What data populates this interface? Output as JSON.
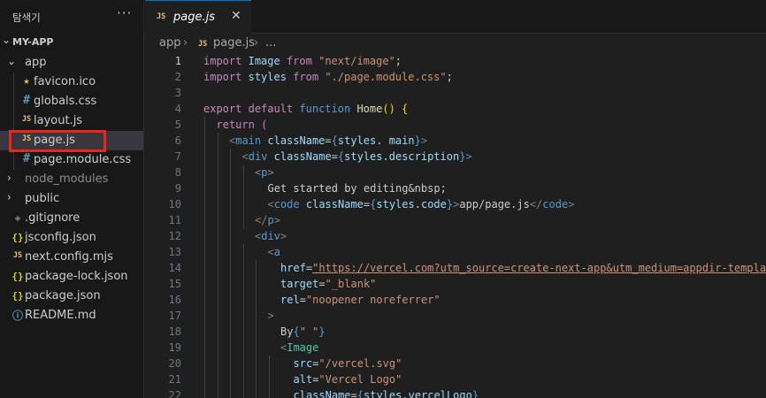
{
  "explorer": {
    "title": "탐색기",
    "more": "···",
    "section": "MY-APP",
    "tree": [
      {
        "name": "app",
        "type": "folder",
        "open": true,
        "indent": 0
      },
      {
        "name": "favicon.ico",
        "icon": "star",
        "indent": 1
      },
      {
        "name": "globals.css",
        "icon": "hash",
        "indent": 1
      },
      {
        "name": "layout.js",
        "icon": "js",
        "indent": 1
      },
      {
        "name": "page.js",
        "icon": "js",
        "indent": 1,
        "selected": true
      },
      {
        "name": "page.module.css",
        "icon": "hash",
        "indent": 1
      },
      {
        "name": "node_modules",
        "type": "folder",
        "open": false,
        "indent": 0,
        "dim": true
      },
      {
        "name": "public",
        "type": "folder",
        "open": false,
        "indent": 0
      },
      {
        "name": ".gitignore",
        "icon": "git",
        "indent": 0
      },
      {
        "name": "jsconfig.json",
        "icon": "brace",
        "indent": 0
      },
      {
        "name": "next.config.mjs",
        "icon": "js",
        "indent": 0
      },
      {
        "name": "package-lock.json",
        "icon": "brace",
        "indent": 0
      },
      {
        "name": "package.json",
        "icon": "brace",
        "indent": 0
      },
      {
        "name": "README.md",
        "icon": "info",
        "indent": 0
      }
    ],
    "icon_glyphs": {
      "js": "JS",
      "hash": "#",
      "star": "★",
      "brace": "{}",
      "git": "◈",
      "info": "ⓘ"
    }
  },
  "tab": {
    "icon": "JS",
    "name": "page.js",
    "close": "✕"
  },
  "breadcrumb": {
    "folder": "app",
    "sep": "›",
    "icon": "JS",
    "file": "page.js",
    "more": "..."
  },
  "editor": {
    "current_line": 1,
    "lines": [
      {
        "n": 1,
        "indent": 0,
        "tokens": [
          [
            "k",
            "import"
          ],
          [
            "",
            "&nbsp;"
          ],
          [
            "v",
            "Image"
          ],
          [
            "",
            "&nbsp;"
          ],
          [
            "k",
            "from"
          ],
          [
            "",
            "&nbsp;"
          ],
          [
            "s",
            "\"next/image\""
          ],
          [
            "",
            ";"
          ]
        ]
      },
      {
        "n": 2,
        "indent": 0,
        "tokens": [
          [
            "k",
            "import"
          ],
          [
            "",
            "&nbsp;"
          ],
          [
            "v",
            "styles"
          ],
          [
            "",
            "&nbsp;"
          ],
          [
            "k",
            "from"
          ],
          [
            "",
            "&nbsp;"
          ],
          [
            "s",
            "\"./page.module.css\""
          ],
          [
            "",
            ";"
          ]
        ]
      },
      {
        "n": 3,
        "indent": 0,
        "tokens": []
      },
      {
        "n": 4,
        "indent": 0,
        "tokens": [
          [
            "k",
            "export"
          ],
          [
            "",
            "&nbsp;"
          ],
          [
            "k",
            "default"
          ],
          [
            "",
            "&nbsp;"
          ],
          [
            "kb",
            "function"
          ],
          [
            "",
            "&nbsp;"
          ],
          [
            "fn",
            "Home"
          ],
          [
            "br",
            "()"
          ],
          [
            "",
            "&nbsp;"
          ],
          [
            "br",
            "{"
          ]
        ]
      },
      {
        "n": 5,
        "indent": 1,
        "tokens": [
          [
            "k",
            "return"
          ],
          [
            "",
            "&nbsp;"
          ],
          [
            "brp",
            "("
          ]
        ]
      },
      {
        "n": 6,
        "indent": 2,
        "tokens": [
          [
            "pun",
            "<"
          ],
          [
            "t",
            "main"
          ],
          [
            "",
            "&nbsp;"
          ],
          [
            "v",
            "className"
          ],
          [
            "",
            "="
          ],
          [
            "kb",
            "{"
          ],
          [
            "v",
            "styles"
          ],
          [
            "",
            ". "
          ],
          [
            "v",
            "main"
          ],
          [
            "kb",
            "}"
          ],
          [
            "pun",
            ">"
          ]
        ]
      },
      {
        "n": 7,
        "indent": 3,
        "tokens": [
          [
            "pun",
            "<"
          ],
          [
            "t",
            "div"
          ],
          [
            "",
            "&nbsp;"
          ],
          [
            "v",
            "className"
          ],
          [
            "",
            "="
          ],
          [
            "kb",
            "{"
          ],
          [
            "v",
            "styles"
          ],
          [
            "",
            "."
          ],
          [
            "v",
            "description"
          ],
          [
            "kb",
            "}"
          ],
          [
            "pun",
            ">"
          ]
        ]
      },
      {
        "n": 8,
        "indent": 4,
        "tokens": [
          [
            "pun",
            "<"
          ],
          [
            "t",
            "p"
          ],
          [
            "pun",
            ">"
          ]
        ]
      },
      {
        "n": 9,
        "indent": 5,
        "tokens": [
          [
            "",
            "Get started by editing"
          ],
          [
            "ent",
            "&amp;nbsp;"
          ]
        ]
      },
      {
        "n": 10,
        "indent": 5,
        "tokens": [
          [
            "pun",
            "<"
          ],
          [
            "t",
            "code"
          ],
          [
            "",
            "&nbsp;"
          ],
          [
            "v",
            "className"
          ],
          [
            "",
            "="
          ],
          [
            "kb",
            "{"
          ],
          [
            "v",
            "styles"
          ],
          [
            "",
            "."
          ],
          [
            "v",
            "code"
          ],
          [
            "kb",
            "}"
          ],
          [
            "pun",
            ">"
          ],
          [
            "",
            "app/page.js"
          ],
          [
            "pun",
            "</"
          ],
          [
            "t",
            "code"
          ],
          [
            "pun",
            ">"
          ]
        ]
      },
      {
        "n": 11,
        "indent": 4,
        "tokens": [
          [
            "pun",
            "</"
          ],
          [
            "t",
            "p"
          ],
          [
            "pun",
            ">"
          ]
        ]
      },
      {
        "n": 12,
        "indent": 4,
        "tokens": [
          [
            "pun",
            "<"
          ],
          [
            "t",
            "div"
          ],
          [
            "pun",
            ">"
          ]
        ]
      },
      {
        "n": 13,
        "indent": 5,
        "tokens": [
          [
            "pun",
            "<"
          ],
          [
            "t",
            "a"
          ]
        ]
      },
      {
        "n": 14,
        "indent": 6,
        "tokens": [
          [
            "v",
            "href"
          ],
          [
            "",
            "="
          ],
          [
            "url",
            "\"https://vercel.com?utm_source=create-next-app&amp;utm_medium=appdir-templa"
          ]
        ]
      },
      {
        "n": 15,
        "indent": 6,
        "tokens": [
          [
            "v",
            "target"
          ],
          [
            "",
            "="
          ],
          [
            "s",
            "\"_blank\""
          ]
        ]
      },
      {
        "n": 16,
        "indent": 6,
        "tokens": [
          [
            "v",
            "rel"
          ],
          [
            "",
            "="
          ],
          [
            "s",
            "\"noopener noreferrer\""
          ]
        ]
      },
      {
        "n": 17,
        "indent": 5,
        "tokens": [
          [
            "pun",
            ">"
          ]
        ]
      },
      {
        "n": 18,
        "indent": 6,
        "tokens": [
          [
            "",
            "By"
          ],
          [
            "kb",
            "{"
          ],
          [
            "s",
            "\" \""
          ],
          [
            "kb",
            "}"
          ]
        ]
      },
      {
        "n": 19,
        "indent": 6,
        "tokens": [
          [
            "pun",
            "<"
          ],
          [
            "comp",
            "Image"
          ]
        ]
      },
      {
        "n": 20,
        "indent": 7,
        "tokens": [
          [
            "v",
            "src"
          ],
          [
            "",
            "="
          ],
          [
            "s",
            "\"/vercel.svg\""
          ]
        ]
      },
      {
        "n": 21,
        "indent": 7,
        "tokens": [
          [
            "v",
            "alt"
          ],
          [
            "",
            "="
          ],
          [
            "s",
            "\"Vercel Logo\""
          ]
        ]
      },
      {
        "n": 22,
        "indent": 7,
        "tokens": [
          [
            "v",
            "className"
          ],
          [
            "",
            "="
          ],
          [
            "kb",
            "{"
          ],
          [
            "v",
            "styles"
          ],
          [
            "",
            "."
          ],
          [
            "v",
            "vercelLogo"
          ],
          [
            "kb",
            "}"
          ]
        ]
      }
    ]
  }
}
